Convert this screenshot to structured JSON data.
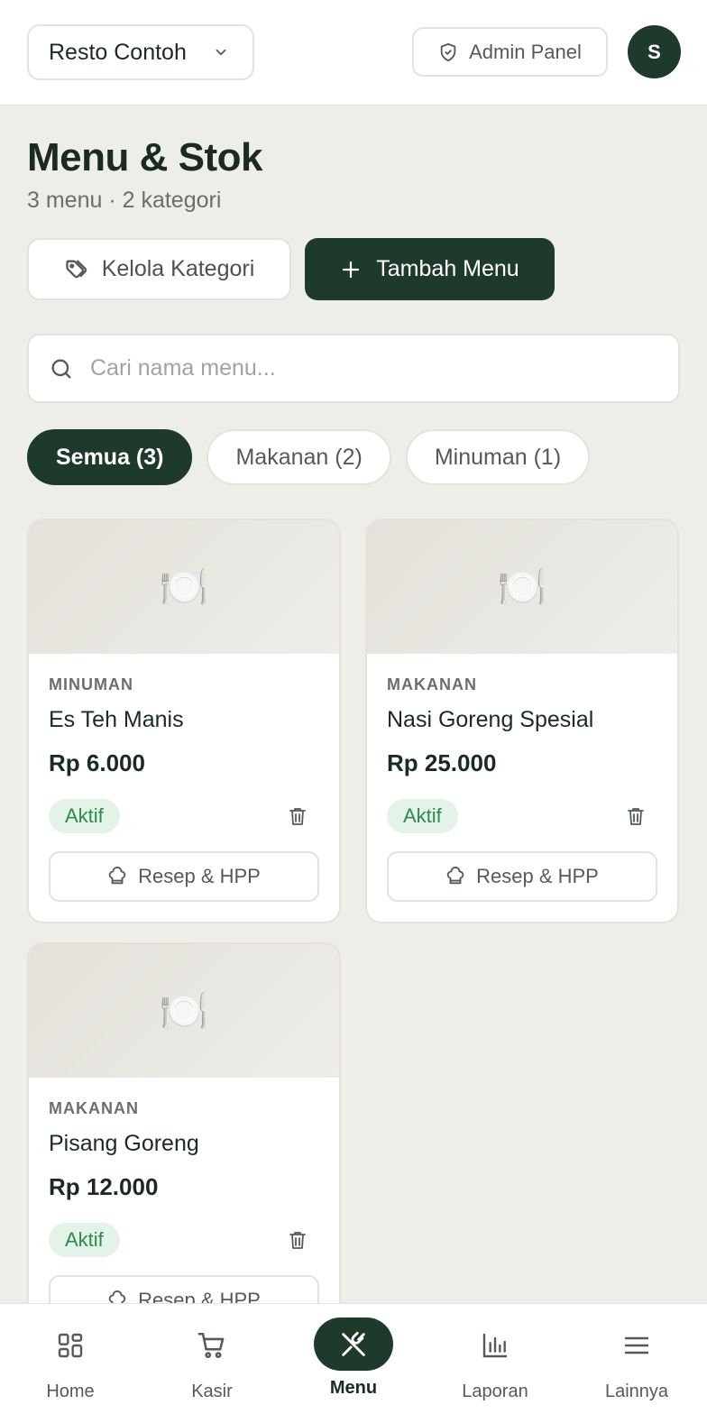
{
  "header": {
    "restaurant_name": "Resto Contoh",
    "admin_label": "Admin Panel",
    "avatar_initial": "S"
  },
  "page": {
    "title": "Menu & Stok",
    "subtitle": "3 menu · 2 kategori"
  },
  "actions": {
    "kelola_label": "Kelola Kategori",
    "tambah_label": "Tambah Menu"
  },
  "search": {
    "placeholder": "Cari nama menu...",
    "value": ""
  },
  "filters": [
    {
      "label": "Semua (3)",
      "active": true
    },
    {
      "label": "Makanan (2)",
      "active": false
    },
    {
      "label": "Minuman (1)",
      "active": false
    }
  ],
  "menu_items": [
    {
      "category": "MINUMAN",
      "name": "Es Teh Manis",
      "price": "Rp 6.000",
      "status": "Aktif",
      "recipe_label": "Resep & HPP",
      "image_icon": "🍽️"
    },
    {
      "category": "MAKANAN",
      "name": "Nasi Goreng Spesial",
      "price": "Rp 25.000",
      "status": "Aktif",
      "recipe_label": "Resep & HPP",
      "image_icon": "🍽️"
    },
    {
      "category": "MAKANAN",
      "name": "Pisang Goreng",
      "price": "Rp 12.000",
      "status": "Aktif",
      "recipe_label": "Resep & HPP",
      "image_icon": "🍽️"
    }
  ],
  "nav": [
    {
      "label": "Home",
      "icon": "grid-icon"
    },
    {
      "label": "Kasir",
      "icon": "cart-icon"
    },
    {
      "label": "Menu",
      "icon": "utensils-icon",
      "active": true
    },
    {
      "label": "Laporan",
      "icon": "bar-chart-icon"
    },
    {
      "label": "Lainnya",
      "icon": "menu-icon"
    }
  ],
  "colors": {
    "primary": "#1E3A2C",
    "background": "#EEEEE9",
    "badge_bg": "#E3F3E8",
    "badge_text": "#2E8A4E"
  }
}
